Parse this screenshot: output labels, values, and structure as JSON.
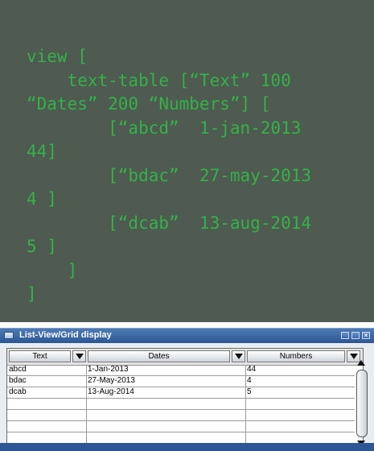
{
  "code": {
    "lines": [
      "view [",
      "    text-table [“Text” 100",
      "“Dates” 200 “Numbers”] [",
      "        [“abcd”  1-jan-2013",
      "44]",
      "        [“bdac”  27-may-2013",
      "4 ]",
      "        [“dcab”  13-aug-2014",
      "5 ]",
      "    ]",
      "]"
    ]
  },
  "window": {
    "title": "List-View/Grid display",
    "buttons": {
      "minimize": "",
      "maximize": "",
      "close": "×"
    },
    "table": {
      "columns": [
        "Text",
        "Dates",
        "Numbers"
      ],
      "rows": [
        [
          "abcd",
          "1-Jan-2013",
          "44"
        ],
        [
          "bdac",
          "27-May-2013",
          "4"
        ],
        [
          "dcab",
          "13-Aug-2014",
          "5"
        ],
        [
          "",
          "",
          ""
        ],
        [
          "",
          "",
          ""
        ],
        [
          "",
          "",
          ""
        ]
      ]
    }
  },
  "colors": {
    "code_background": "#4f5a50",
    "code_text": "#33b24a",
    "titlebar": "#2c5794",
    "window_bg": "#e9edf2"
  }
}
